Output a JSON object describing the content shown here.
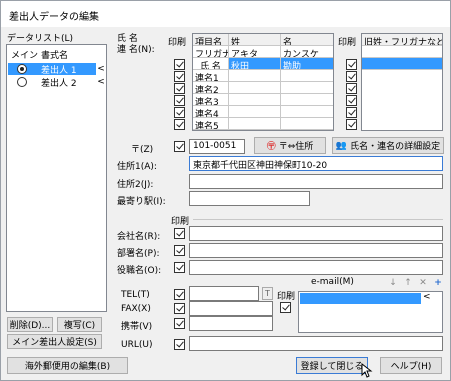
{
  "window": {
    "title": "差出人データの編集"
  },
  "datalist": {
    "label": "データリスト(L)",
    "col_main": "メイン",
    "col_name": "書式名",
    "rows": [
      {
        "name": "差出人 1",
        "selected": true,
        "marker": "<"
      },
      {
        "name": "差出人 2",
        "selected": false,
        "marker": "<"
      }
    ],
    "delete_label": "削除(D)...",
    "copy_label": "複写(C)",
    "main_sender_label": "メイン差出人設定(S)"
  },
  "names": {
    "section_label": "氏 名\n連 名(N):",
    "print_label": "印刷",
    "col_item": "項目名",
    "col_last": "姓",
    "col_first": "名",
    "rows": [
      {
        "item": "フリガナ",
        "last": "アキタ",
        "first": "カンスケ"
      },
      {
        "item": "氏 名",
        "last": "秋田",
        "first": "勘助"
      },
      {
        "item": "連名1",
        "last": "",
        "first": ""
      },
      {
        "item": "連名2",
        "last": "",
        "first": ""
      },
      {
        "item": "連名3",
        "last": "",
        "first": ""
      },
      {
        "item": "連名4",
        "last": "",
        "first": ""
      },
      {
        "item": "連名5",
        "last": "",
        "first": ""
      }
    ],
    "right_print_label": "印刷",
    "right_col_label": "旧姓・フリガナなど"
  },
  "address": {
    "zip_label": "〒(Z)",
    "zip_value": "101-0051",
    "zip_convert_label": "〒⇔住所",
    "detail_label": "氏名・連名の詳細設定",
    "addr1_label": "住所1(A):",
    "addr1_value": "東京都千代田区神田神保町10-20",
    "addr2_label": "住所2(J):",
    "addr2_value": "",
    "station_label": "最寄り駅(I):",
    "station_value": ""
  },
  "company": {
    "print_label": "印刷",
    "company_label": "会社名(R):",
    "dept_label": "部署名(P):",
    "title_label": "役職名(O):"
  },
  "contact": {
    "tel_label": "TEL(T)",
    "fax_label": "FAX(X)",
    "mobile_label": "携帯(V)",
    "url_label": "URL(U)",
    "print_label": "印刷",
    "email_label": "e-mail(M)",
    "email_marker": "<"
  },
  "footer": {
    "overseas_label": "海外郵便用の編集(B)",
    "save_close_label": "登録して閉じる",
    "help_label": "ヘルプ(H)"
  }
}
